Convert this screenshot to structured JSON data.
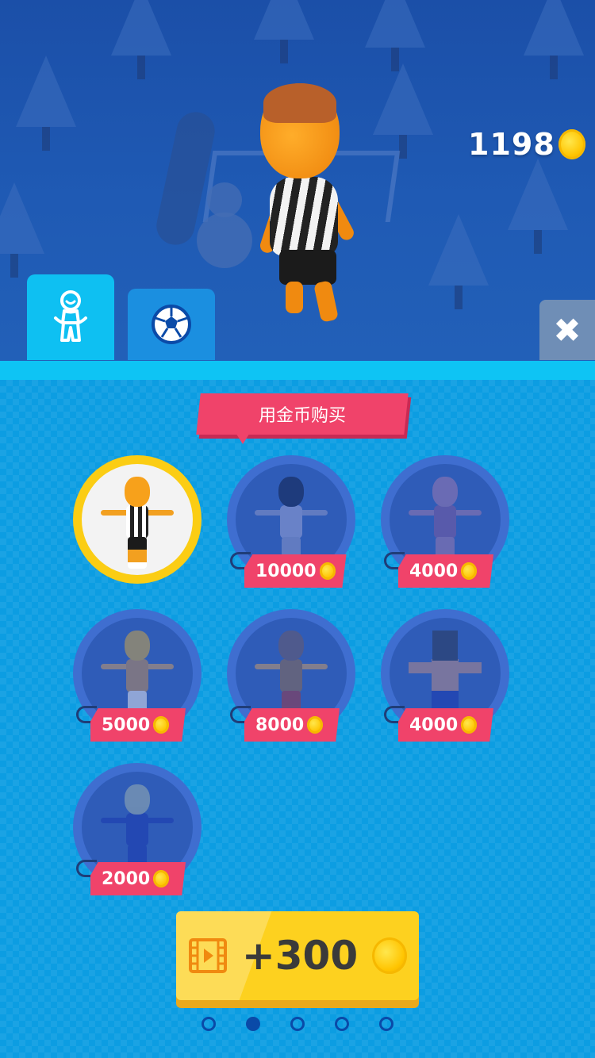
{
  "hud": {
    "coins": "1198"
  },
  "tabs": [
    {
      "icon": "character-icon",
      "active": true
    },
    {
      "icon": "soccer-ball-icon",
      "active": false
    }
  ],
  "close": {
    "icon": "close-icon",
    "label": "✖"
  },
  "shop": {
    "banner": "用金币购买",
    "skins": [
      {
        "name": "referee",
        "owned": true,
        "selected": true,
        "price": ""
      },
      {
        "name": "astronaut",
        "owned": false,
        "price": "10000"
      },
      {
        "name": "crash-dummy",
        "owned": false,
        "price": "4000"
      },
      {
        "name": "pharaoh",
        "owned": false,
        "price": "5000"
      },
      {
        "name": "gladiator",
        "owned": false,
        "price": "8000"
      },
      {
        "name": "blocky",
        "owned": false,
        "price": "4000"
      },
      {
        "name": "blue-suit",
        "owned": false,
        "price": "2000"
      }
    ]
  },
  "reward": {
    "icon": "video-icon",
    "amount": "+300"
  },
  "pager": {
    "count": 5,
    "active_index": 1
  },
  "colors": {
    "accent": "#f0436a",
    "coin": "#ffc400",
    "panel": "#0c9de2",
    "tab_active": "#0ec0f2"
  }
}
